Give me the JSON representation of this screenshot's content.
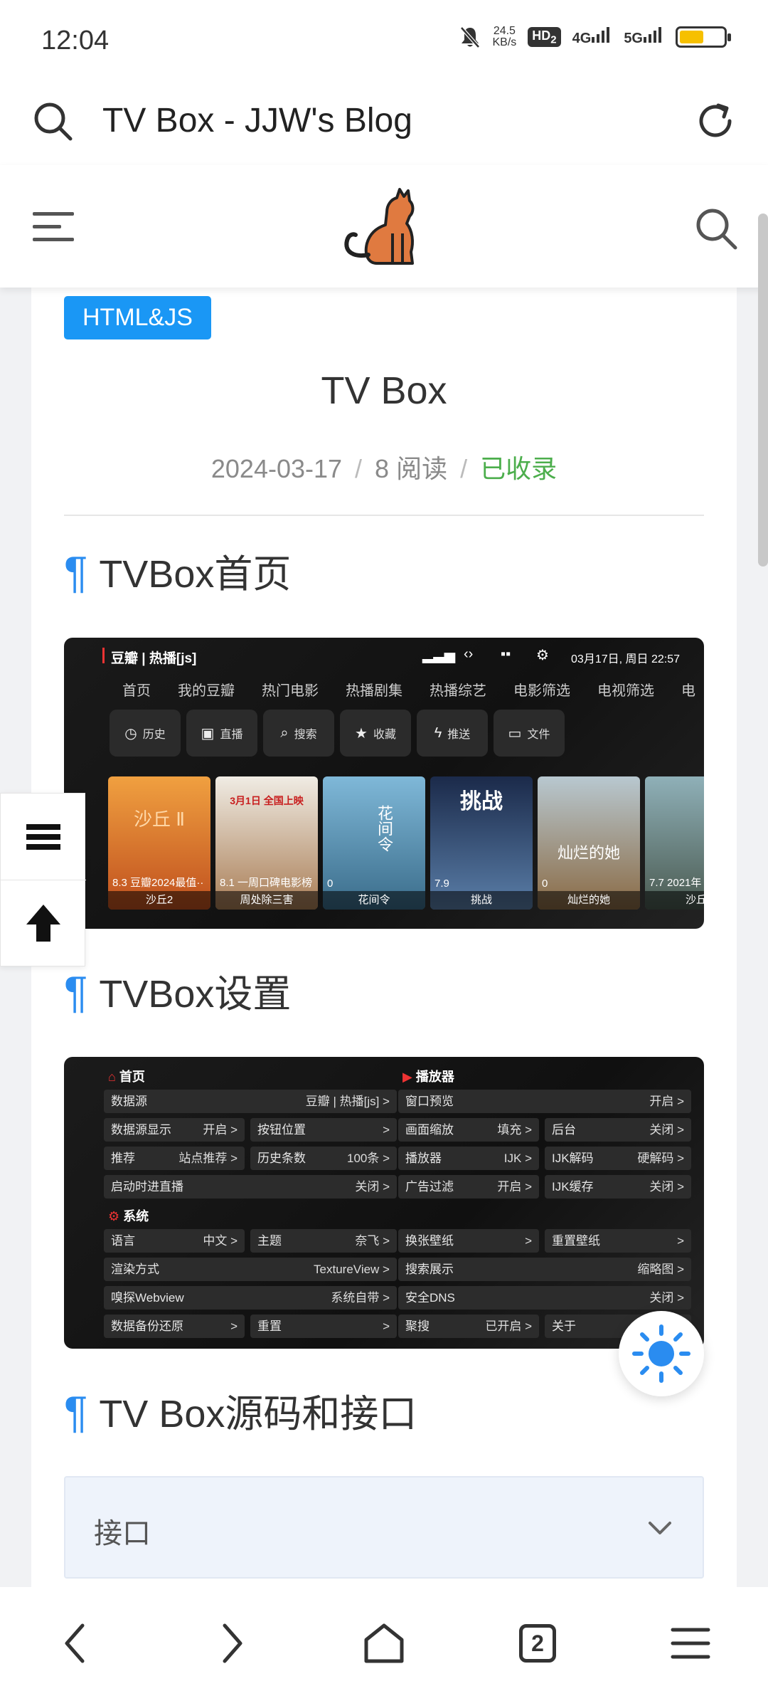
{
  "status": {
    "time": "12:04",
    "net_speed_value": "24.5",
    "net_speed_unit": "KB/s",
    "hd": "HD",
    "hd_sub": "2",
    "sig1": "4G",
    "sig2": "5G"
  },
  "browser": {
    "page_title": "TV Box - JJW's Blog",
    "tabs_count": "2"
  },
  "post": {
    "category_tag": "HTML&JS",
    "title": "TV Box",
    "date": "2024-03-17",
    "sep": "/",
    "reads": "8 阅读",
    "indexed": "已收录",
    "pilcrow": "¶",
    "sections": [
      "TVBox首页",
      "TVBox设置",
      "TV Box源码和接口"
    ],
    "accordion_label": "接口"
  },
  "shot1": {
    "brand": "豆瓣 | 热播[js]",
    "clock": "03月17日, 周日 22:57",
    "nav": [
      "首页",
      "我的豆瓣",
      "热门电影",
      "热播剧集",
      "热播综艺",
      "电影筛选",
      "电视筛选",
      "电"
    ],
    "buttons": [
      "历史",
      "直播",
      "搜索",
      "收藏",
      "推送",
      "文件"
    ],
    "posters": [
      {
        "score": "8.3 豆瓣2024最值··",
        "name": "沙丘2",
        "poster_text": "沙丘 Ⅱ"
      },
      {
        "score": "8.1 一周口碑电影榜",
        "name": "周处除三害",
        "poster_text": "3月1日 全国上映"
      },
      {
        "score": "0",
        "name": "花间令",
        "poster_text": "花间令"
      },
      {
        "score": "7.9",
        "name": "挑战",
        "poster_text": "挑战"
      },
      {
        "score": "0",
        "name": "灿烂的她",
        "poster_text": "灿烂的她"
      },
      {
        "score": "7.7 2021年",
        "name": "沙丘",
        "poster_text": ""
      }
    ]
  },
  "shot2": {
    "home": "首页",
    "player": "播放器",
    "system": "系统",
    "left_rows": [
      {
        "k": "数据源",
        "v": "豆瓣 | 热播[js] >"
      },
      {
        "k": "数据源显示",
        "v": "开启 >"
      },
      {
        "k": "按钮位置",
        "v": ">"
      },
      {
        "k": "推荐",
        "v": "站点推荐 >"
      },
      {
        "k": "历史条数",
        "v": "100条 >"
      },
      {
        "k": "启动时进直播",
        "v": "关闭 >"
      }
    ],
    "right_rows": [
      {
        "k": "窗口预览",
        "v": "开启 >"
      },
      {
        "k": "画面缩放",
        "v": "填充 >"
      },
      {
        "k": "后台",
        "v": "关闭 >"
      },
      {
        "k": "播放器",
        "v": "IJK >"
      },
      {
        "k": "IJK解码",
        "v": "硬解码 >"
      },
      {
        "k": "广告过滤",
        "v": "开启 >"
      },
      {
        "k": "IJK缓存",
        "v": "关闭 >"
      }
    ],
    "sys_rows": [
      {
        "k": "语言",
        "v": "中文 >"
      },
      {
        "k": "主题",
        "v": "奈飞 >"
      },
      {
        "k": "换张壁纸",
        "v": ">"
      },
      {
        "k": "重置壁纸",
        "v": ">"
      },
      {
        "k": "渲染方式",
        "v": "TextureView >"
      },
      {
        "k": "搜索展示",
        "v": "缩略图 >"
      },
      {
        "k": "嗅探Webview",
        "v": "系统自带 >"
      },
      {
        "k": "安全DNS",
        "v": "关闭 >"
      },
      {
        "k": "数据备份还原",
        "v": ">"
      },
      {
        "k": "重置",
        "v": ">"
      },
      {
        "k": "聚搜",
        "v": "已开启 >"
      },
      {
        "k": "关于",
        "v": ""
      }
    ]
  },
  "colors": {
    "accent": "#1a97f5",
    "pilcrow": "#2a8cf0",
    "indexed_green": "#4cae4c",
    "battery": "#f6c000"
  },
  "icons": [
    "search-icon",
    "refresh-icon",
    "menu-icon",
    "cat-logo-icon",
    "sun-icon",
    "list-icon",
    "arrow-up-icon",
    "back-icon",
    "forward-icon",
    "home-icon",
    "tabs-icon",
    "more-menu-icon",
    "chevron-down-icon"
  ]
}
